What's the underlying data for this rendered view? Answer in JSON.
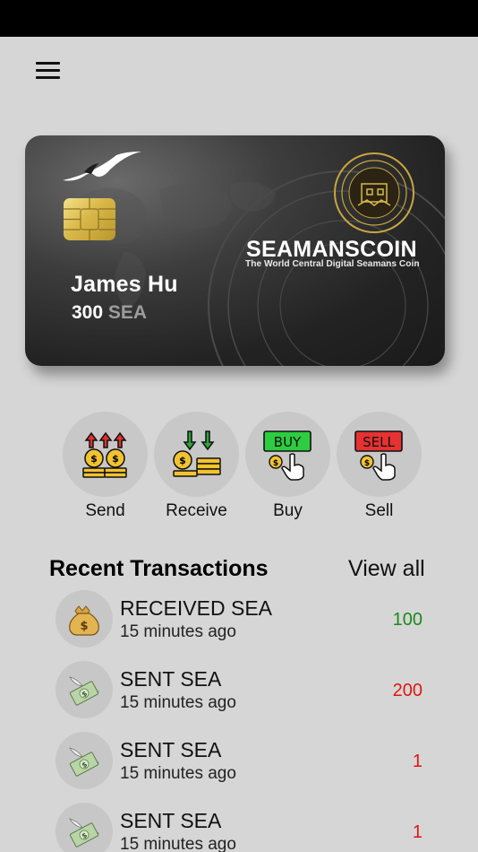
{
  "card": {
    "holder_name": "James Hu",
    "balance": "300",
    "balance_unit": "SEA",
    "brand": "SEAMANSCOIN",
    "tagline": "The World Central Digital Seamans Coin"
  },
  "actions": [
    {
      "label": "Send",
      "icon": "send-coins-icon"
    },
    {
      "label": "Receive",
      "icon": "receive-coins-icon"
    },
    {
      "label": "Buy",
      "icon": "buy-icon",
      "badge": "BUY"
    },
    {
      "label": "Sell",
      "icon": "sell-icon",
      "badge": "SELL"
    }
  ],
  "transactions_section": {
    "title": "Recent Transactions",
    "view_all_label": "View all"
  },
  "transactions": [
    {
      "title": "RECEIVED SEA",
      "time": "15 minutes ago",
      "amount": "100",
      "icon": "money-bag-icon",
      "color": "#1a8a1a"
    },
    {
      "title": "SENT SEA",
      "time": "15 minutes ago",
      "amount": "200",
      "icon": "money-wings-icon",
      "color": "#e01616"
    },
    {
      "title": "SENT SEA",
      "time": "15 minutes ago",
      "amount": "1",
      "icon": "money-wings-icon",
      "color": "#e01616"
    },
    {
      "title": "SENT SEA",
      "time": "15 minutes ago",
      "amount": "1",
      "icon": "money-wings-icon",
      "color": "#e01616"
    }
  ],
  "colors": {
    "background": "#d6d6d6",
    "received": "#1a8a1a",
    "sent": "#e01616",
    "buy_badge": "#2ecc40",
    "sell_badge": "#e63232"
  }
}
